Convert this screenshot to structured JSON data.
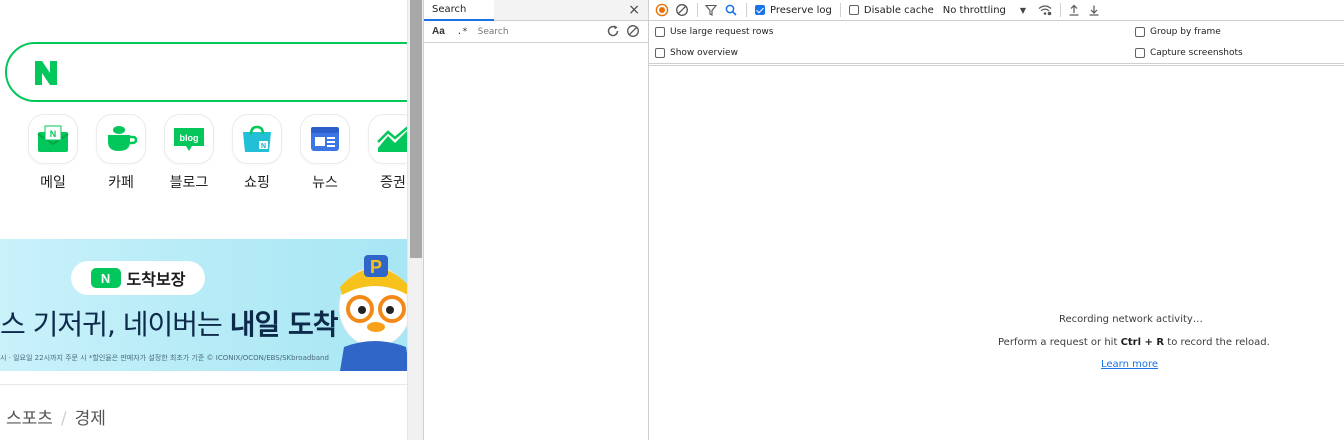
{
  "naver": {
    "logo_letter": "N",
    "shortcuts": [
      {
        "label": "메일",
        "icon": "mail-icon"
      },
      {
        "label": "카페",
        "icon": "cafe-icon"
      },
      {
        "label": "블로그",
        "icon": "blog-icon"
      },
      {
        "label": "쇼핑",
        "icon": "shopping-icon"
      },
      {
        "label": "뉴스",
        "icon": "news-icon"
      },
      {
        "label": "증권",
        "icon": "stock-icon"
      }
    ],
    "blog_icon_text": "blog",
    "banner": {
      "pill_n": "N",
      "pill_text": "도착보장",
      "headline_regular": "스 기저귀, 네이버는 ",
      "headline_bold": "내일 도착",
      "fine_print": "시 · 일요일 22시까지 주문 시 *할인율은 판매자가 설정한 최초가 기준  © ICONIX/OCON/EBS/SKbroadband"
    },
    "breadcrumb": {
      "items": [
        "스포츠",
        "경제"
      ],
      "separator": "/"
    }
  },
  "search_panel": {
    "tab_label": "Search",
    "case_toggle": "Aa",
    "regex_toggle": ".*",
    "input_placeholder": "Search",
    "input_value": ""
  },
  "network": {
    "toolbar": {
      "preserve_log": "Preserve log",
      "preserve_log_checked": true,
      "disable_cache": "Disable cache",
      "disable_cache_checked": false,
      "throttling": "No throttling"
    },
    "settings": {
      "large_rows": "Use large request rows",
      "group_by_frame": "Group by frame",
      "show_overview": "Show overview",
      "capture_screenshots": "Capture screenshots"
    },
    "empty_state": {
      "line1": "Recording network activity…",
      "line2_prefix": "Perform a request or hit ",
      "line2_shortcut": "Ctrl + R",
      "line2_suffix": " to record the reload.",
      "learn_more": "Learn more"
    }
  },
  "colors": {
    "naver_green": "#03c75a",
    "devtools_blue": "#1a73e8",
    "record_orange": "#e8710a"
  }
}
